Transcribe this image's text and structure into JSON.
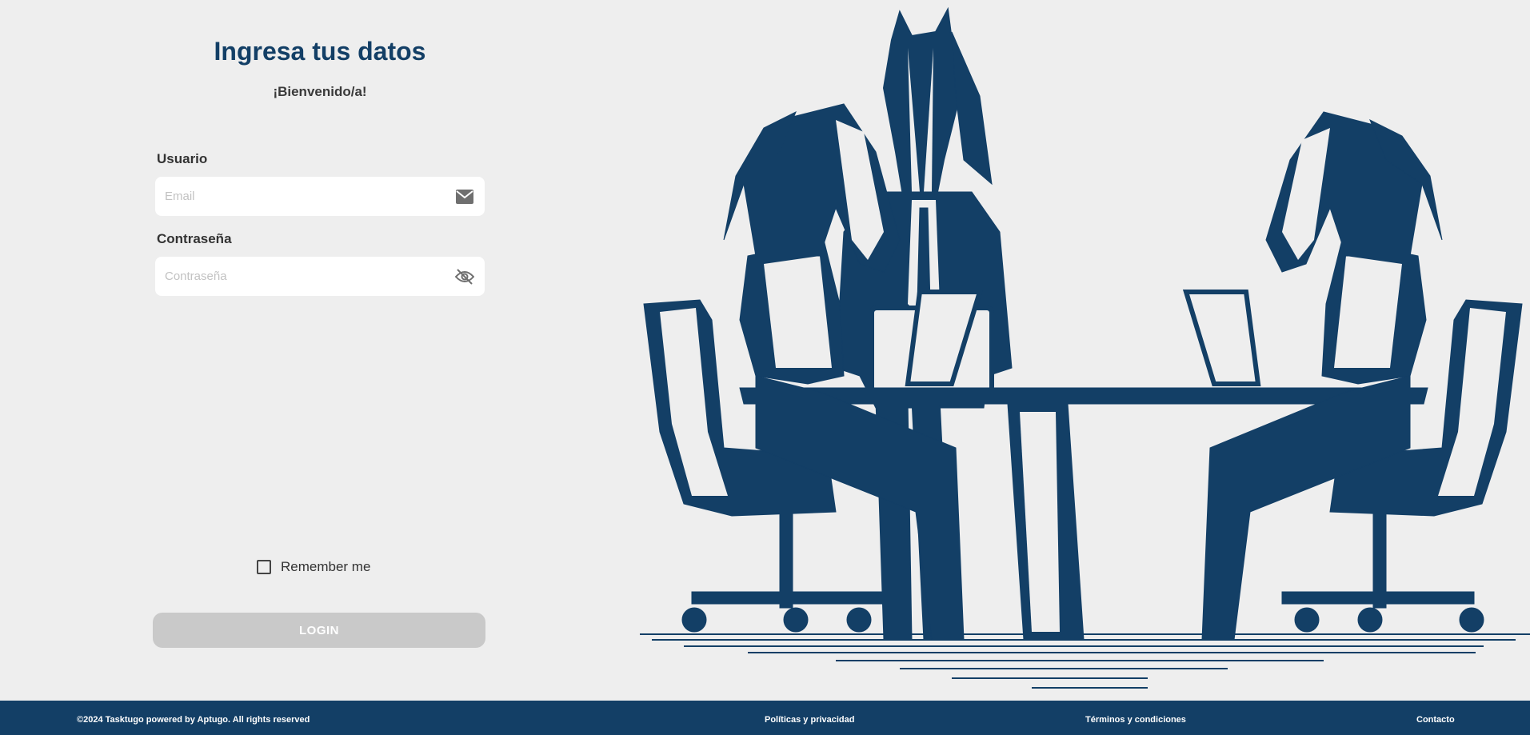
{
  "login": {
    "title": "Ingresa tus datos",
    "subtitle": "¡Bienvenido/a!",
    "username_label": "Usuario",
    "username_placeholder": "Email",
    "password_label": "Contraseña",
    "password_placeholder": "Contraseña",
    "remember_label": "Remember me",
    "login_button": "LOGIN",
    "icons": {
      "username": "mail-icon",
      "password": "eye-off-icon"
    }
  },
  "footer": {
    "copyright": "©2024 Tasktugo powered by Aptugo. All rights reserved",
    "links": [
      "Políticas y privacidad",
      "Términos y condiciones",
      "Contacto"
    ]
  },
  "colors": {
    "primary": "#133f66",
    "background": "#eeeeee",
    "button_disabled": "#c9c9c9"
  }
}
